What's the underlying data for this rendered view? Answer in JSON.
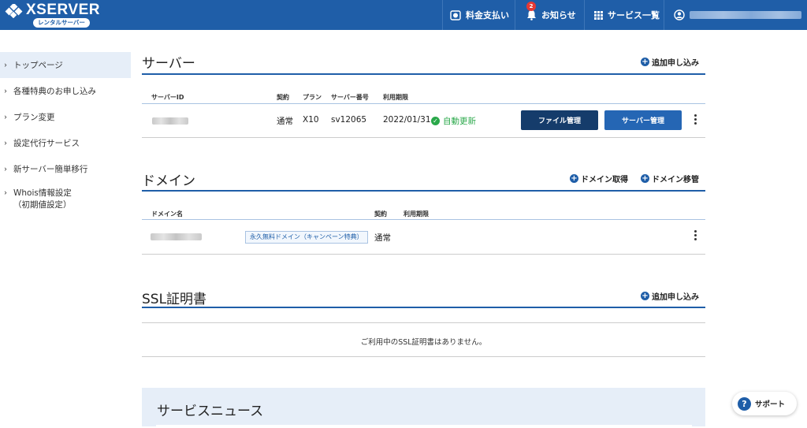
{
  "header": {
    "logo_text": "XSERVER",
    "logo_sub": "レンタルサーバー",
    "nav": {
      "payment": "料金支払い",
      "notice": "お知らせ",
      "notice_badge": "2",
      "services": "サービス一覧"
    }
  },
  "sidebar": {
    "items": [
      {
        "label": "トップページ"
      },
      {
        "label": "各種特典のお申し込み"
      },
      {
        "label": "プラン変更"
      },
      {
        "label": "設定代行サービス"
      },
      {
        "label": "新サーバー簡単移行"
      },
      {
        "label": "Whois情報設定",
        "label2": "（初期値設定）"
      }
    ]
  },
  "server": {
    "title": "サーバー",
    "add_label": "追加申し込み",
    "headers": {
      "id": "サーバーID",
      "contract": "契約",
      "plan": "プラン",
      "number": "サーバー番号",
      "expiry": "利用期限"
    },
    "row": {
      "contract": "通常",
      "plan": "X10",
      "number": "sv12065",
      "expiry": "2022/01/31",
      "status": "自動更新"
    },
    "file_btn": "ファイル管理",
    "server_btn": "サーバー管理"
  },
  "domain": {
    "title": "ドメイン",
    "acquire_label": "ドメイン取得",
    "transfer_label": "ドメイン移管",
    "headers": {
      "name": "ドメイン名",
      "contract": "契約",
      "expiry": "利用期限"
    },
    "row": {
      "tag": "永久無料ドメイン（キャンペーン特典）",
      "contract": "通常"
    }
  },
  "ssl": {
    "title": "SSL証明書",
    "add_label": "追加申し込み",
    "empty": "ご利用中のSSL証明書はありません。"
  },
  "news": {
    "title": "サービスニュース"
  },
  "support": {
    "label": "サポート"
  },
  "colors": {
    "brand": "#1f5ea8",
    "dark_button": "#153c6b",
    "status_green": "#2aa84a",
    "badge_red": "#e53935"
  }
}
